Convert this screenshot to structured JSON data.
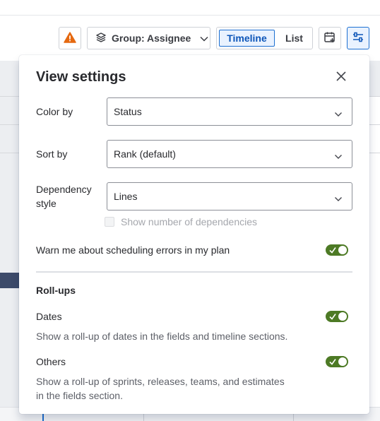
{
  "toolbar": {
    "group_label": "Group: Assignee",
    "view_modes": [
      {
        "label": "Timeline",
        "selected": true
      },
      {
        "label": "List",
        "selected": false
      }
    ],
    "icons": {
      "warning": "warning-icon",
      "layers": "layers-icon",
      "calendar": "calendar-add-icon",
      "settings": "view-settings-icon"
    }
  },
  "view_settings": {
    "title": "View settings",
    "color_by": {
      "label": "Color by",
      "value": "Status"
    },
    "sort_by": {
      "label": "Sort by",
      "value": "Rank (default)"
    },
    "dependency_style": {
      "label_line1": "Dependency",
      "label_line2": "style",
      "value": "Lines"
    },
    "show_dependencies": {
      "label": "Show number of dependencies",
      "checked": false,
      "disabled": true
    },
    "warn_scheduling": {
      "label": "Warn me about scheduling errors in my plan",
      "on": true
    },
    "rollups": {
      "heading": "Roll-ups",
      "dates": {
        "label": "Dates",
        "description": "Show a roll-up of dates in the fields and timeline sections.",
        "on": true
      },
      "others": {
        "label": "Others",
        "description_line1": "Show a roll-up of sprints, releases, teams, and estimates",
        "description_line2": "in the fields section.",
        "on": true
      }
    }
  },
  "colors": {
    "accent_blue": "#1d6fd1",
    "toggle_on": "#4d7a25",
    "warning": "#e56910"
  }
}
